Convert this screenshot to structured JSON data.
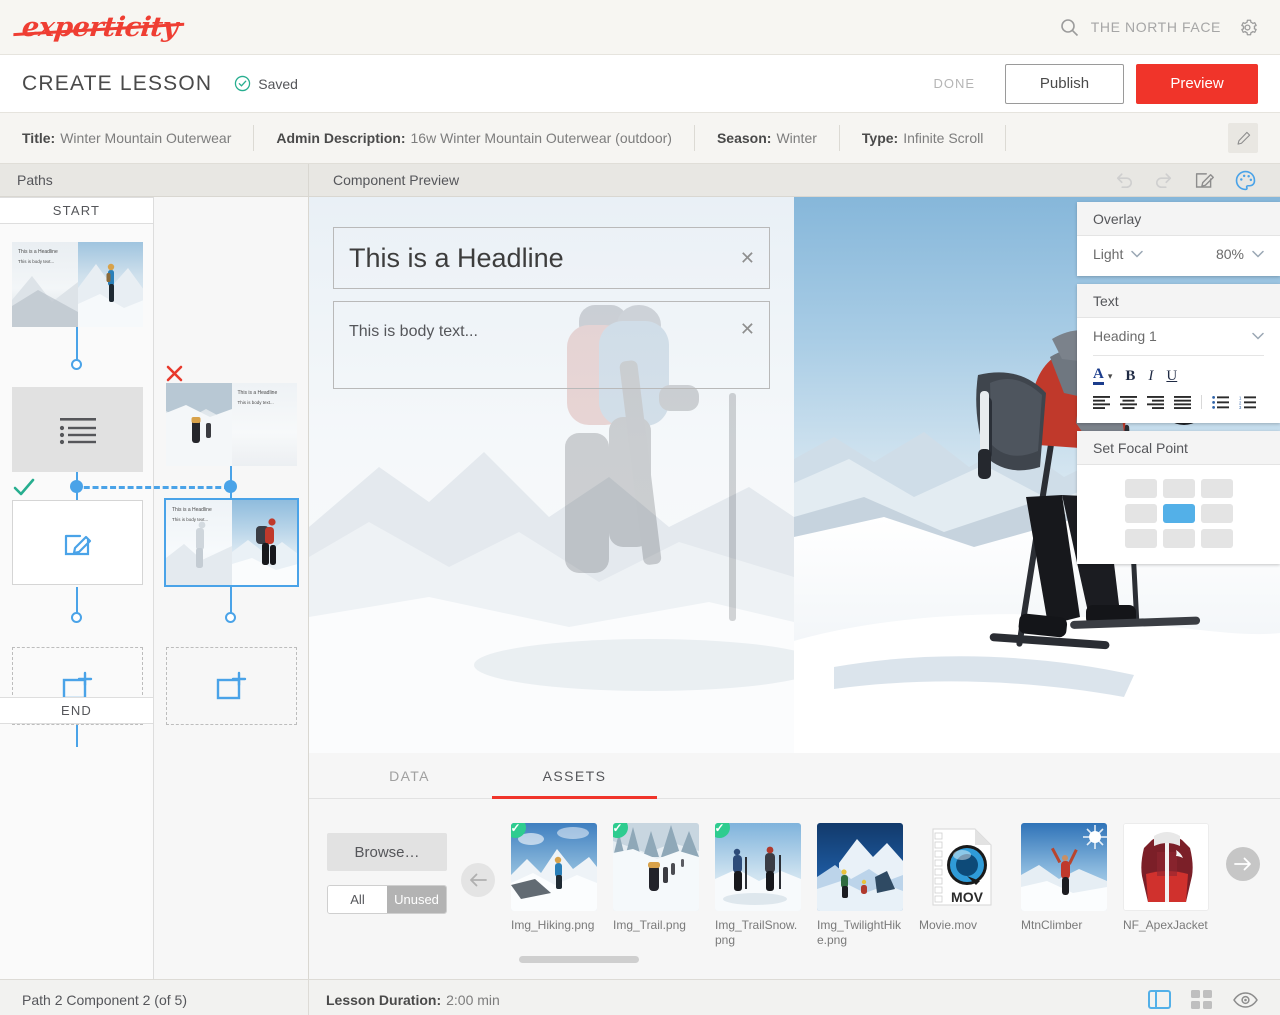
{
  "brand": {
    "logo_text": "experticity",
    "logo_color": "#ef3e33",
    "search_icon": "search-icon",
    "search_value": "THE NORTH FACE",
    "settings_icon": "gear-icon"
  },
  "lesson_header": {
    "title": "CREATE LESSON",
    "saved_label": "Saved",
    "saved_icon": "check-circle-icon",
    "saved_color": "#27ae8f",
    "done_label": "DONE",
    "publish_label": "Publish",
    "preview_label": "Preview",
    "preview_color": "#f0342a"
  },
  "meta": {
    "items": [
      {
        "label": "Title:",
        "value": "Winter Mountain Outerwear"
      },
      {
        "label": "Admin Description:",
        "value": "16w Winter Mountain Outerwear (outdoor)"
      },
      {
        "label": "Season:",
        "value": "Winter"
      },
      {
        "label": "Type:",
        "value": "Infinite Scroll"
      }
    ],
    "edit_icon": "pencil-icon"
  },
  "paths": {
    "panel_title": "Paths",
    "start_label": "START",
    "end_label": "END",
    "mini_headline": "This is a Headline",
    "mini_body": "This is body text...",
    "path1": {
      "node1": "image-split-component",
      "node2": "list-component",
      "node3": "text-edit-component",
      "node4": "add-component",
      "status_icon": "check-icon",
      "status_color": "#27ae8f"
    },
    "path2": {
      "node1": "image-split-component",
      "node2": "image-split-component-selected",
      "node3": "add-component",
      "status_icon": "x-icon",
      "status_color": "#e8392c"
    }
  },
  "preview": {
    "panel_title": "Component Preview",
    "tools": [
      {
        "name": "undo-icon",
        "disabled": true
      },
      {
        "name": "redo-icon",
        "disabled": true
      },
      {
        "name": "edit-icon",
        "disabled": false
      },
      {
        "name": "palette-icon",
        "disabled": false,
        "active": true
      }
    ],
    "headline_value": "This is a Headline",
    "body_value": "This is body text...",
    "close_icon": "close-icon"
  },
  "settings": {
    "overlay": {
      "title": "Overlay",
      "style_value": "Light",
      "opacity_value": "80%",
      "chevron_icon": "chevron-down-icon"
    },
    "text": {
      "title": "Text",
      "style_value": "Heading 1",
      "chevron_icon": "chevron-down-icon",
      "format_buttons": [
        "font-color-icon",
        "font-color-dropdown-icon",
        "bold-icon",
        "italic-icon",
        "underline-icon"
      ],
      "align_buttons": [
        "align-left-icon",
        "align-center-icon",
        "align-right-icon",
        "align-justify-icon",
        "bullet-list-icon",
        "numbered-list-icon"
      ]
    },
    "focal": {
      "title": "Set Focal Point",
      "active_cell": 4,
      "active_color": "#53b0e8",
      "cells": 9
    }
  },
  "tabs": [
    {
      "label": "DATA",
      "active": false
    },
    {
      "label": "ASSETS",
      "active": true
    }
  ],
  "assets_panel": {
    "browse_label": "Browse…",
    "filter": {
      "all_label": "All",
      "unused_label": "Unused",
      "selected": "All"
    },
    "prev_icon": "arrow-left-icon",
    "next_icon": "arrow-right-icon",
    "check_icon": "check-icon",
    "items": [
      {
        "name": "Img_Hiking.png",
        "selected": true,
        "kind": "image"
      },
      {
        "name": "Img_Trail.png",
        "selected": true,
        "kind": "image"
      },
      {
        "name": "Img_TrailSnow.png",
        "selected": true,
        "kind": "image"
      },
      {
        "name": "Img_TwilightHike.png",
        "selected": false,
        "kind": "image"
      },
      {
        "name": "Movie.mov",
        "selected": false,
        "kind": "video",
        "badge": "MOV"
      },
      {
        "name": "MtnClimber",
        "selected": false,
        "kind": "image"
      },
      {
        "name": "NF_ApexJacket",
        "selected": false,
        "kind": "image"
      }
    ]
  },
  "status": {
    "position": "Path 2 Component 2 (of 5)",
    "duration_label": "Lesson Duration:",
    "duration_value": "2:00 min",
    "view_icons": [
      {
        "name": "split-view-icon",
        "active": true
      },
      {
        "name": "grid-view-icon",
        "active": false
      },
      {
        "name": "eye-preview-icon",
        "active": false
      }
    ]
  }
}
